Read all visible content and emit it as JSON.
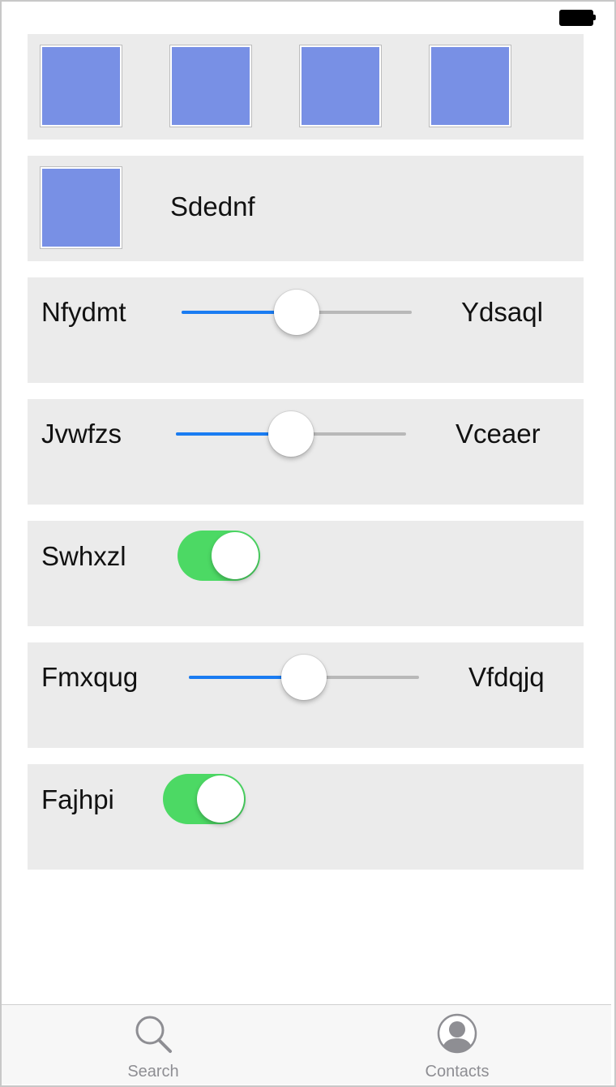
{
  "status_bar": {
    "battery_icon": "battery-icon"
  },
  "rows": {
    "images_row": {
      "tile_count": 4
    },
    "image_label_row": {
      "label": "Sdednf"
    },
    "slider_1": {
      "left_label": "Nfydmt",
      "right_label": "Ydsaql",
      "value": 0.5
    },
    "slider_2": {
      "left_label": "Jvwfzs",
      "right_label": "Vceaer",
      "value": 0.5
    },
    "switch_1": {
      "label": "Swhxzl",
      "on": true
    },
    "slider_3": {
      "left_label": "Fmxqug",
      "right_label": "Vfdqjq",
      "value": 0.5
    },
    "switch_2": {
      "label": "Fajhpi",
      "on": true
    }
  },
  "tab_bar": {
    "tabs": [
      {
        "label": "Search",
        "icon": "search-icon"
      },
      {
        "label": "Contacts",
        "icon": "contacts-icon"
      }
    ]
  },
  "colors": {
    "tile": "#7890e5",
    "row_background": "#ebebeb",
    "slider_fill": "#1a7cf2",
    "switch_on": "#4cd964",
    "tab_inactive": "#8e8e93"
  }
}
